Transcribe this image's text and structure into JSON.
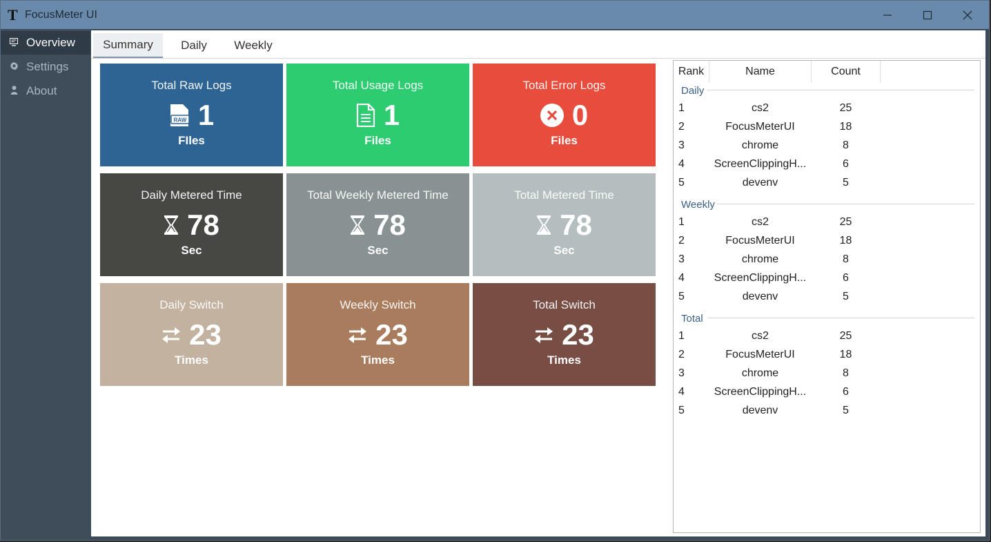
{
  "window": {
    "title": "FocusMeter UI",
    "logo": "𝕿",
    "controls": [
      "minimize",
      "maximize",
      "close"
    ]
  },
  "sidebar": {
    "items": [
      {
        "label": "Overview",
        "icon": "monitor-icon",
        "active": true
      },
      {
        "label": "Settings",
        "icon": "gear-icon",
        "active": false
      },
      {
        "label": "About",
        "icon": "person-icon",
        "active": false
      }
    ]
  },
  "tabs": [
    {
      "label": "Summary",
      "active": true
    },
    {
      "label": "Daily",
      "active": false
    },
    {
      "label": "Weekly",
      "active": false
    }
  ],
  "tiles": [
    {
      "title": "Total Raw Logs",
      "value": "1",
      "unit": "FIles",
      "icon": "raw-file-icon",
      "color": "#2d6493"
    },
    {
      "title": "Total Usage Logs",
      "value": "1",
      "unit": "Files",
      "icon": "document-icon",
      "color": "#2ecc71"
    },
    {
      "title": "Total Error Logs",
      "value": "0",
      "unit": "Files",
      "icon": "error-circle-icon",
      "color": "#e74c3c"
    },
    {
      "title": "Daily Metered Time",
      "value": "78",
      "unit": "Sec",
      "icon": "hourglass-icon",
      "color": "#474744"
    },
    {
      "title": "Total Weekly Metered Time",
      "value": "78",
      "unit": "Sec",
      "icon": "hourglass-icon",
      "color": "#899292"
    },
    {
      "title": "Total Metered Time",
      "value": "78",
      "unit": "Sec",
      "icon": "hourglass-icon",
      "color": "#b5bebf"
    },
    {
      "title": "Daily Switch",
      "value": "23",
      "unit": "Times",
      "icon": "switch-arrows-icon",
      "color": "#c3b2a0"
    },
    {
      "title": "Weekly Switch",
      "value": "23",
      "unit": "Times",
      "icon": "switch-arrows-icon",
      "color": "#a97c5d"
    },
    {
      "title": "Total Switch",
      "value": "23",
      "unit": "Times",
      "icon": "switch-arrows-icon",
      "color": "#784d44"
    }
  ],
  "ranking": {
    "headers": [
      "Rank",
      "Name",
      "Count"
    ],
    "groups": [
      {
        "label": "Daily",
        "rows": [
          {
            "rank": "1",
            "name": "cs2",
            "count": "25"
          },
          {
            "rank": "2",
            "name": "FocusMeterUI",
            "count": "18"
          },
          {
            "rank": "3",
            "name": "chrome",
            "count": "8"
          },
          {
            "rank": "4",
            "name": "ScreenClippingH...",
            "count": "6"
          },
          {
            "rank": "5",
            "name": "devenv",
            "count": "5"
          }
        ]
      },
      {
        "label": "Weekly",
        "rows": [
          {
            "rank": "1",
            "name": "cs2",
            "count": "25"
          },
          {
            "rank": "2",
            "name": "FocusMeterUI",
            "count": "18"
          },
          {
            "rank": "3",
            "name": "chrome",
            "count": "8"
          },
          {
            "rank": "4",
            "name": "ScreenClippingH...",
            "count": "6"
          },
          {
            "rank": "5",
            "name": "devenv",
            "count": "5"
          }
        ]
      },
      {
        "label": "Total",
        "rows": [
          {
            "rank": "1",
            "name": "cs2",
            "count": "25"
          },
          {
            "rank": "2",
            "name": "FocusMeterUI",
            "count": "18"
          },
          {
            "rank": "3",
            "name": "chrome",
            "count": "8"
          },
          {
            "rank": "4",
            "name": "ScreenClippingH...",
            "count": "6"
          },
          {
            "rank": "5",
            "name": "devenv",
            "count": "5"
          }
        ]
      }
    ]
  }
}
